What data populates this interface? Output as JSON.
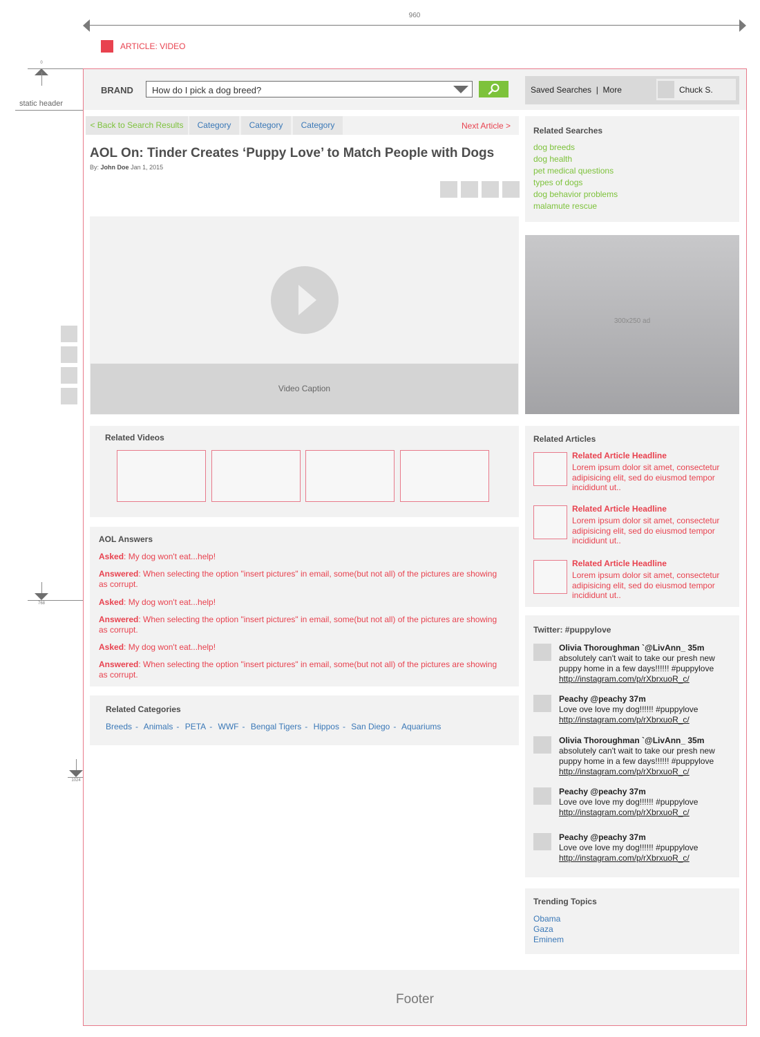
{
  "annotation": {
    "width_label": "960",
    "legend_label": "ARTICLE: VIDEO",
    "static_header_label": "static header",
    "marker_top": "0",
    "marker_mid": "768",
    "marker_low": "1024"
  },
  "header": {
    "brand": "BRAND",
    "search_value": "How do I pick a dog breed?",
    "saved_searches": "Saved Searches",
    "more": "More",
    "user_name": "Chuck S."
  },
  "nav": {
    "back": "< Back to Search Results",
    "categories": [
      "Category",
      "Category",
      "Category"
    ],
    "next": "Next Article >"
  },
  "article": {
    "title": "AOL On: Tinder Creates ‘Puppy Love’ to Match People with Dogs",
    "by_prefix": "By:",
    "author": "John Doe",
    "date": "Jan 1, 2015",
    "video_caption": "Video Caption"
  },
  "related_videos": {
    "title": "Related Videos"
  },
  "answers": {
    "title": "AOL Answers",
    "items": [
      {
        "label": "Asked",
        "text": ": My dog won't eat...help!"
      },
      {
        "label": "Answered",
        "text": ": When selecting the option \"insert pictures\" in email, some(but not all) of the pictures are showing as corrupt."
      },
      {
        "label": "Asked",
        "text": ": My dog won't eat...help!"
      },
      {
        "label": "Answered",
        "text": ": When selecting the option \"insert pictures\" in email, some(but not all) of the pictures are showing as corrupt."
      },
      {
        "label": "Asked",
        "text": ": My dog won't eat...help!"
      },
      {
        "label": "Answered",
        "text": ": When selecting the option \"insert pictures\" in email, some(but not all) of the pictures are showing as corrupt."
      }
    ]
  },
  "related_categories": {
    "title": "Related Categories",
    "items": [
      "Breeds",
      "Animals",
      "PETA",
      "WWF",
      "Bengal Tigers",
      "Hippos",
      "San Diego",
      "Aquariums"
    ]
  },
  "sidebar": {
    "related_searches": {
      "title": "Related Searches",
      "items": [
        "dog breeds",
        "dog health",
        "pet medical questions",
        "types of dogs",
        "dog behavior problems",
        "malamute rescue"
      ]
    },
    "ad_label": "300x250 ad",
    "related_articles": {
      "title": "Related Articles",
      "items": [
        {
          "headline": "Related Article Headline",
          "body": "Lorem ipsum dolor sit amet, consectetur adipisicing elit, sed do eiusmod tempor incididunt ut.."
        },
        {
          "headline": "Related Article Headline",
          "body": "Lorem ipsum dolor sit amet, consectetur adipisicing elit, sed do eiusmod tempor incididunt ut.."
        },
        {
          "headline": "Related Article Headline",
          "body": "Lorem ipsum dolor sit amet, consectetur adipisicing elit, sed do eiusmod tempor incididunt ut.."
        }
      ]
    },
    "twitter": {
      "title": "Twitter: #puppylove",
      "tweets": [
        {
          "name": "Olivia Thoroughman `@LivAnn_  35m",
          "body": "absolutely can't wait to take our presh new puppy home in a few days!!!!!! #puppylove",
          "link": "http://instagram.com/p/rXbrxuoR_c/"
        },
        {
          "name": "Peachy @peachy  37m",
          "body": "Love ove love my dog!!!!!! #puppylove",
          "link": "http://instagram.com/p/rXbrxuoR_c/"
        },
        {
          "name": "Olivia Thoroughman `@LivAnn_  35m",
          "body": "absolutely can't wait to take our presh new puppy home in a few days!!!!!! #puppylove",
          "link": "http://instagram.com/p/rXbrxuoR_c/"
        },
        {
          "name": "Peachy @peachy  37m",
          "body": "Love ove love my dog!!!!!! #puppylove",
          "link": "http://instagram.com/p/rXbrxuoR_c/"
        },
        {
          "name": "Peachy @peachy  37m",
          "body": "Love ove love my dog!!!!!! #puppylove",
          "link": "http://instagram.com/p/rXbrxuoR_c/"
        }
      ]
    },
    "trending": {
      "title": "Trending Topics",
      "items": [
        "Obama",
        "Gaza",
        "Eminem"
      ]
    }
  },
  "footer": {
    "label": "Footer"
  },
  "colors": {
    "accent_red": "#e8424f",
    "accent_green": "#7dc23b",
    "link_blue": "#3a78b7"
  }
}
